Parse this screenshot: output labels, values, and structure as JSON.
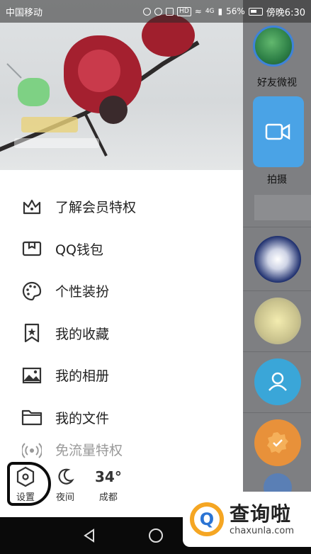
{
  "status_bar": {
    "carrier": "中国移动",
    "battery_percent": "56%",
    "time": "傍晚6:30",
    "network": "4G",
    "hd": "HD"
  },
  "menu": {
    "items": [
      {
        "label": "了解会员特权",
        "icon": "crown-icon"
      },
      {
        "label": "QQ钱包",
        "icon": "wallet-icon"
      },
      {
        "label": "个性装扮",
        "icon": "palette-icon"
      },
      {
        "label": "我的收藏",
        "icon": "bookmark-star-icon"
      },
      {
        "label": "我的相册",
        "icon": "photo-icon"
      },
      {
        "label": "我的文件",
        "icon": "folder-icon"
      },
      {
        "label": "免流量特权",
        "icon": "broadcast-icon"
      }
    ]
  },
  "bottom": {
    "settings_label": "设置",
    "night_label": "夜间",
    "temperature": "34°",
    "city": "成都"
  },
  "right_panel": {
    "friends_label": "好友微视",
    "shoot_label": "拍摄"
  },
  "watermark": {
    "cn": "查询啦",
    "en": "chaxunla.com",
    "logo_letter": "Q"
  },
  "colors": {
    "accent_blue": "#4aa3e6",
    "menu_text": "#222222",
    "flower_red": "#a4202f"
  }
}
